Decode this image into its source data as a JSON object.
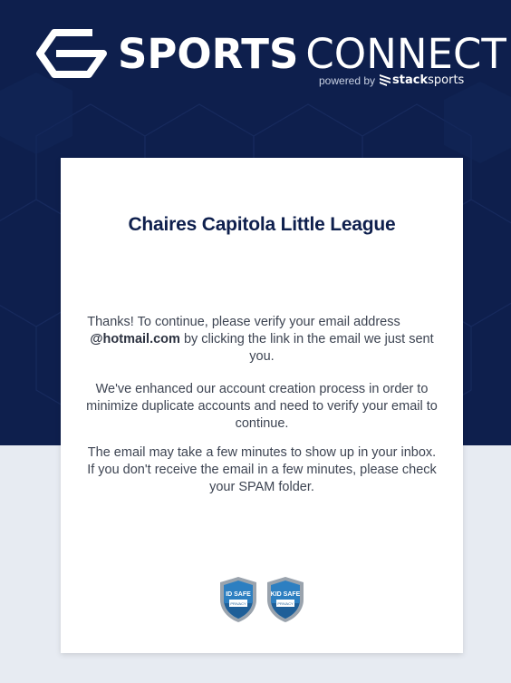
{
  "brand": {
    "name_bold": "SPORTS",
    "name_light": "CONNECT",
    "powered_by": "powered by",
    "stack_bold": "stack",
    "stack_light": "sports"
  },
  "card": {
    "title": "Chaires Capitola Little League",
    "message1_a": "Thanks! To continue, please verify your email address",
    "email_domain": "@hotmail.com",
    "message1_b": "by clicking the link in the email we just sent you.",
    "message2": "We've enhanced our account creation process in order to minimize duplicate accounts and need to verify your email to continue.",
    "message3": "The email may take a few minutes to show up in your inbox. If you don't receive the email in a few minutes, please check your SPAM folder."
  },
  "badges": [
    {
      "title": "ID SAFE",
      "subtitle": "PRIVACY"
    },
    {
      "title": "KID SAFE",
      "subtitle": "PRIVACY"
    }
  ],
  "colors": {
    "hero": "#0e1f4d",
    "page_bg": "#e7ebf2",
    "title": "#0e1f4d",
    "badge_blue": "#2d7fc1"
  }
}
